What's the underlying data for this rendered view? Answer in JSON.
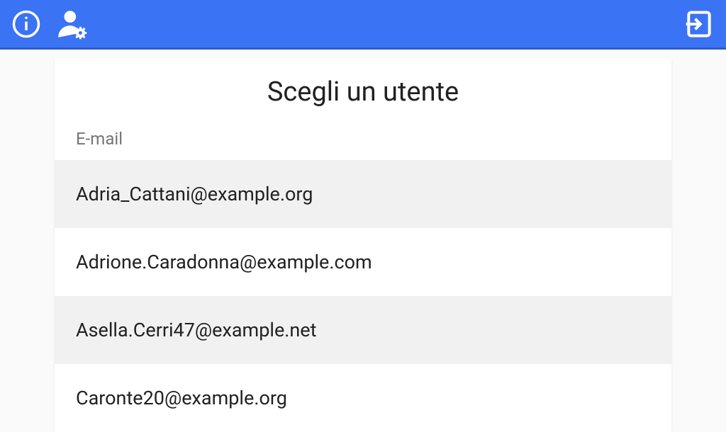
{
  "header": {
    "info_icon": "info",
    "user_settings_icon": "user-settings",
    "exit_icon": "exit"
  },
  "card": {
    "title": "Scegli un utente",
    "column_header": "E-mail",
    "rows": [
      {
        "email": "Adria_Cattani@example.org"
      },
      {
        "email": "Adrione.Caradonna@example.com"
      },
      {
        "email": "Asella.Cerri47@example.net"
      },
      {
        "email": "Caronte20@example.org"
      }
    ]
  }
}
